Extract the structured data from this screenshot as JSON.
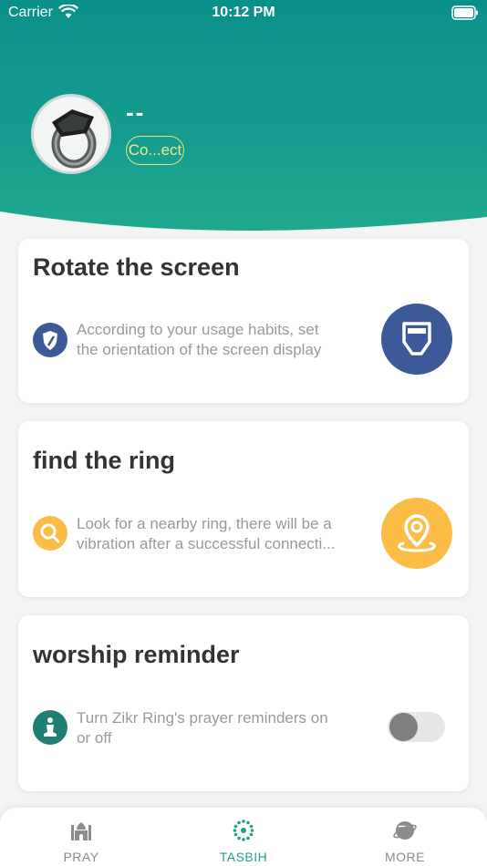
{
  "status_bar": {
    "carrier": "Carrier",
    "time": "10:12 PM"
  },
  "device": {
    "name": "--",
    "connect_label": "Co...ect"
  },
  "cards": [
    {
      "title": "Rotate the screen",
      "description": [
        "According to your usage habits, set",
        "the orientation of the screen display"
      ],
      "icon": "shield-icon",
      "action_icon": "screen-rotate-icon",
      "accent_color": "#3d5a98"
    },
    {
      "title": "find the ring",
      "description": [
        "Look for a nearby ring, there will be a",
        "vibration after a successful connecti..."
      ],
      "icon": "search-icon",
      "action_icon": "location-pin-icon",
      "accent_color": "#fbbd46"
    },
    {
      "title": "worship reminder",
      "description": [
        "Turn Zikr Ring's prayer reminders on",
        "or off"
      ],
      "icon": "praying-person-icon",
      "toggle_on": false,
      "accent_color": "#1f7f74"
    }
  ],
  "tabs": [
    {
      "label": "PRAY",
      "icon": "mosque-icon",
      "active": false
    },
    {
      "label": "TASBIH",
      "icon": "tasbih-beads-icon",
      "active": true
    },
    {
      "label": "MORE",
      "icon": "planet-icon",
      "active": false
    }
  ],
  "colors": {
    "header_start": "#0a8f8c",
    "header_end": "#24ad8d",
    "active_tab": "#22a08a"
  }
}
